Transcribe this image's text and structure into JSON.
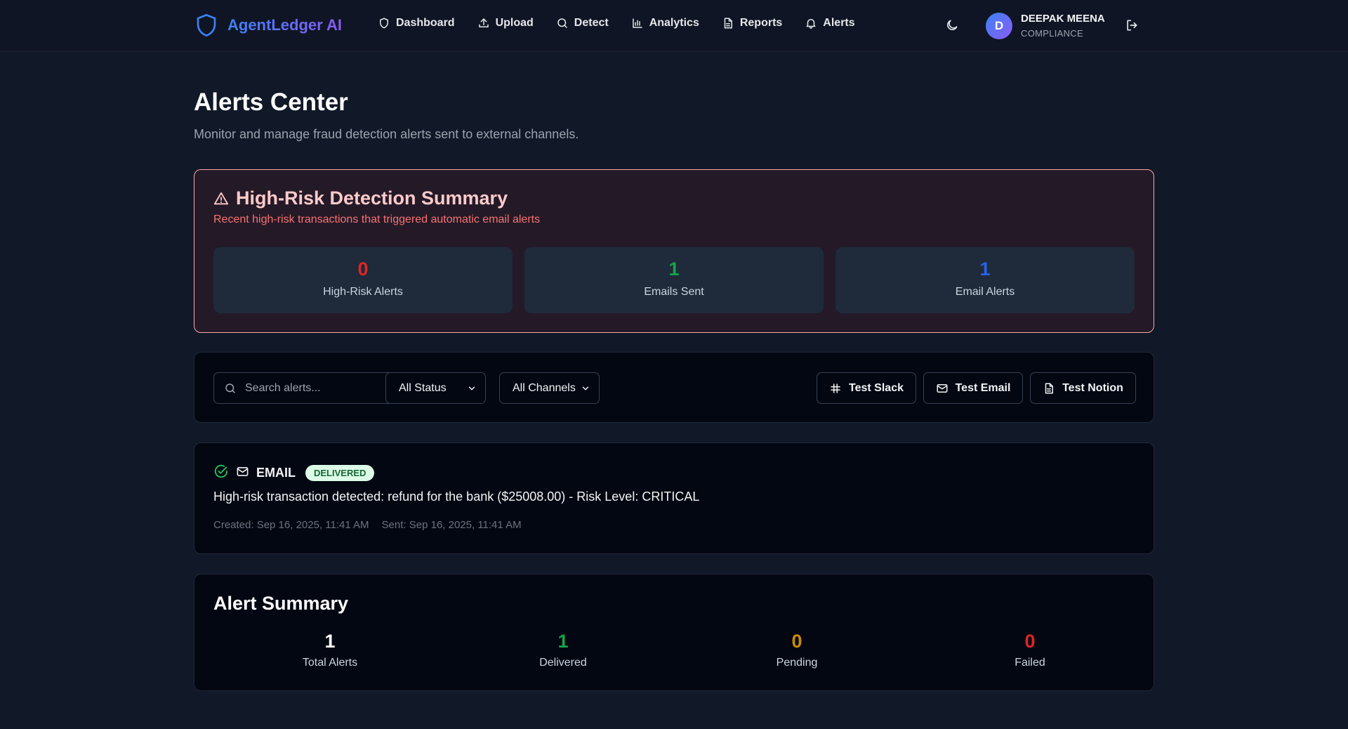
{
  "app": {
    "brand": "AgentLedger AI"
  },
  "nav": {
    "items": [
      {
        "label": "Dashboard",
        "icon": "shield-icon"
      },
      {
        "label": "Upload",
        "icon": "upload-icon"
      },
      {
        "label": "Detect",
        "icon": "search-icon"
      },
      {
        "label": "Analytics",
        "icon": "bar-chart-icon"
      },
      {
        "label": "Reports",
        "icon": "file-icon"
      },
      {
        "label": "Alerts",
        "icon": "bell-icon"
      }
    ]
  },
  "user": {
    "initial": "D",
    "name": "DEEPAK MEENA",
    "role": "COMPLIANCE"
  },
  "page": {
    "title": "Alerts Center",
    "subtitle": "Monitor and manage fraud detection alerts sent to external channels."
  },
  "risk_summary": {
    "title": "High-Risk Detection Summary",
    "subtitle": "Recent high-risk transactions that triggered automatic email alerts",
    "stats": [
      {
        "value": "0",
        "label": "High-Risk Alerts",
        "color": "#dc2626"
      },
      {
        "value": "1",
        "label": "Emails Sent",
        "color": "#16a34a"
      },
      {
        "value": "1",
        "label": "Email Alerts",
        "color": "#2563eb"
      }
    ]
  },
  "filters": {
    "search_placeholder": "Search alerts...",
    "status_selected": "All Status",
    "channel_selected": "All Channels",
    "test_slack": "Test Slack",
    "test_email": "Test Email",
    "test_notion": "Test Notion"
  },
  "alerts": [
    {
      "channel": "EMAIL",
      "status": "DELIVERED",
      "message": "High-risk transaction detected: refund for the bank ($25008.00) - Risk Level: CRITICAL",
      "created": "Created: Sep 16, 2025, 11:41 AM",
      "sent": "Sent: Sep 16, 2025, 11:41 AM"
    }
  ],
  "alert_summary": {
    "title": "Alert Summary",
    "stats": [
      {
        "value": "1",
        "label": "Total Alerts",
        "color": "#ffffff"
      },
      {
        "value": "1",
        "label": "Delivered",
        "color": "#16a34a"
      },
      {
        "value": "0",
        "label": "Pending",
        "color": "#ca8a04"
      },
      {
        "value": "0",
        "label": "Failed",
        "color": "#dc2626"
      }
    ]
  }
}
